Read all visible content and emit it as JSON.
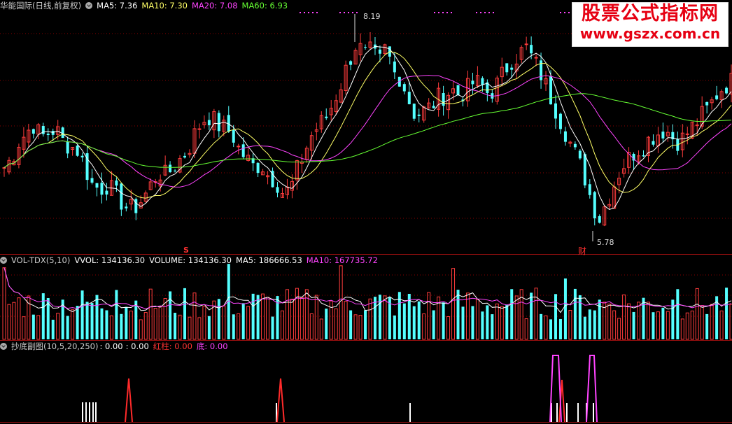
{
  "price_header": {
    "stock": "华能国际(日线,前复权)",
    "ma5": "MA5: 7.36",
    "ma10": "MA10: 7.30",
    "ma20": "MA20: 7.08",
    "ma60": "MA60: 6.93"
  },
  "vol_header": {
    "name": "VOL-TDX(5,10)",
    "vvol": "VVOL: 134136.30",
    "volume": "VOLUME: 134136.30",
    "ma5": "MA5: 186666.53",
    "ma10": "MA10: 167735.72"
  },
  "ind_header": {
    "name": "抄底副图(10,5,20,250)",
    "v1": ": 0.00",
    "v2": ": 0.00",
    "hongzhu": "红柱: 0.00",
    "di": "底: 0.00"
  },
  "annotations": {
    "high": "8.19",
    "low": "5.78",
    "s_marker": "S",
    "cai_marker": "财"
  },
  "watermark": {
    "title": "股票公式指标网",
    "url": "www.gszx.com.cn"
  },
  "colors": {
    "up": "#ff3c3c",
    "down": "#54ffff",
    "ma5": "#ffffff",
    "ma10": "#ffff66",
    "ma20": "#ff44ff",
    "ma60": "#66ff33",
    "grid": "#8b0000"
  },
  "chart_data": {
    "type": "candlestick",
    "y_range": [
      5.6,
      8.3
    ],
    "high_close_seed": [
      6.5,
      6.6,
      6.8,
      6.9,
      7.0,
      6.85,
      6.9,
      6.95,
      6.8,
      6.75,
      6.7,
      6.5,
      6.3,
      6.25,
      6.3,
      6.2,
      6.1,
      6.0,
      6.05,
      6.15,
      6.3,
      6.45,
      6.4,
      6.5,
      6.6,
      6.7,
      6.9,
      7.05,
      7.1,
      7.0,
      6.95,
      6.9,
      6.7,
      6.6,
      6.5,
      6.55,
      6.4,
      6.35,
      6.2,
      6.25,
      6.5,
      6.7,
      6.9,
      7.0,
      7.1,
      7.3,
      7.5,
      7.75,
      7.95,
      7.8,
      7.85,
      7.7,
      7.9,
      7.6,
      7.55,
      7.3,
      7.1,
      7.15,
      7.2,
      7.3,
      7.35,
      7.4,
      7.35,
      7.4,
      7.5,
      7.45,
      7.35,
      7.45,
      7.6,
      7.75,
      7.8,
      7.9,
      7.75,
      7.6,
      7.4,
      7.2,
      7.0,
      6.8,
      6.6,
      6.4,
      6.1,
      5.9,
      6.1,
      6.3,
      6.5,
      6.6,
      6.7,
      6.75,
      6.85,
      6.9,
      6.95,
      6.85,
      6.8,
      6.9,
      7.0,
      7.1,
      7.2,
      7.35,
      7.45,
      7.5
    ]
  }
}
